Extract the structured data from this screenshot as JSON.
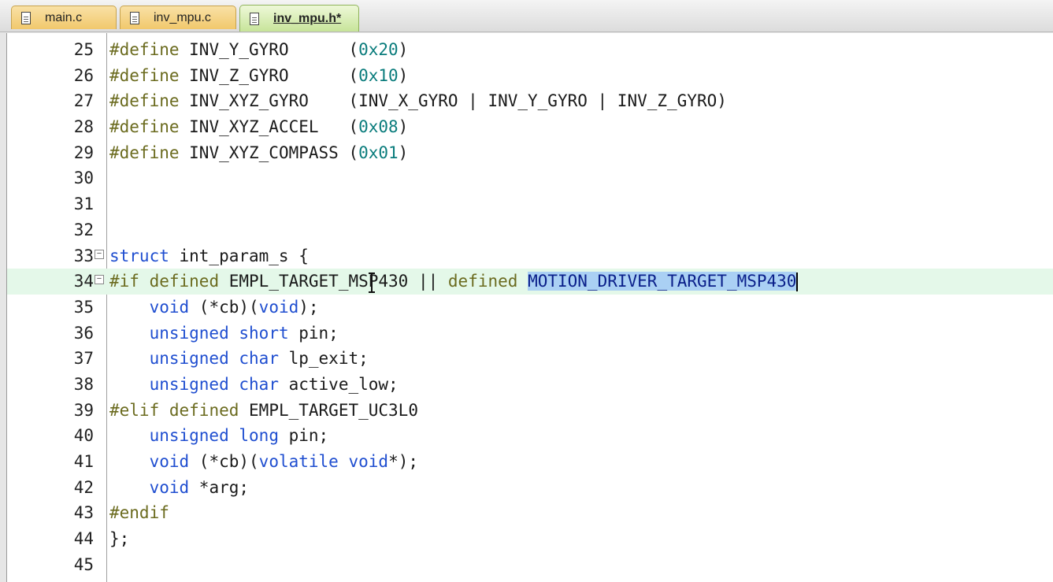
{
  "tabs": [
    {
      "label": "main.c",
      "active": false
    },
    {
      "label": "inv_mpu.c",
      "active": false
    },
    {
      "label": "inv_mpu.h*",
      "active": true
    }
  ],
  "colors": {
    "preprocessor": "#6b6b1f",
    "keyword": "#1f4ed0",
    "number": "#0a7c7c",
    "selection": "#aad0f4",
    "current_line": "#e4f8e9"
  },
  "lines": [
    {
      "num": "25",
      "text": "#define INV_Y_GYRO      (0x20)"
    },
    {
      "num": "26",
      "text": "#define INV_Z_GYRO      (0x10)"
    },
    {
      "num": "27",
      "text": "#define INV_XYZ_GYRO    (INV_X_GYRO | INV_Y_GYRO | INV_Z_GYRO)"
    },
    {
      "num": "28",
      "text": "#define INV_XYZ_ACCEL   (0x08)"
    },
    {
      "num": "29",
      "text": "#define INV_XYZ_COMPASS (0x01)"
    },
    {
      "num": "30",
      "text": ""
    },
    {
      "num": "31",
      "text": ""
    },
    {
      "num": "32",
      "text": ""
    },
    {
      "num": "33",
      "text": "struct int_param_s {"
    },
    {
      "num": "34",
      "text": "#if defined EMPL_TARGET_MSP430 || defined MOTION_DRIVER_TARGET_MSP430"
    },
    {
      "num": "35",
      "text": "    void (*cb)(void);"
    },
    {
      "num": "36",
      "text": "    unsigned short pin;"
    },
    {
      "num": "37",
      "text": "    unsigned char lp_exit;"
    },
    {
      "num": "38",
      "text": "    unsigned char active_low;"
    },
    {
      "num": "39",
      "text": "#elif defined EMPL_TARGET_UC3L0"
    },
    {
      "num": "40",
      "text": "    unsigned long pin;"
    },
    {
      "num": "41",
      "text": "    void (*cb)(volatile void*);"
    },
    {
      "num": "42",
      "text": "    void *arg;"
    },
    {
      "num": "43",
      "text": "#endif"
    },
    {
      "num": "44",
      "text": "};"
    },
    {
      "num": "45",
      "text": ""
    }
  ],
  "current_line": "34",
  "selected_text": "MOTION_DRIVER_TARGET_MSP430"
}
